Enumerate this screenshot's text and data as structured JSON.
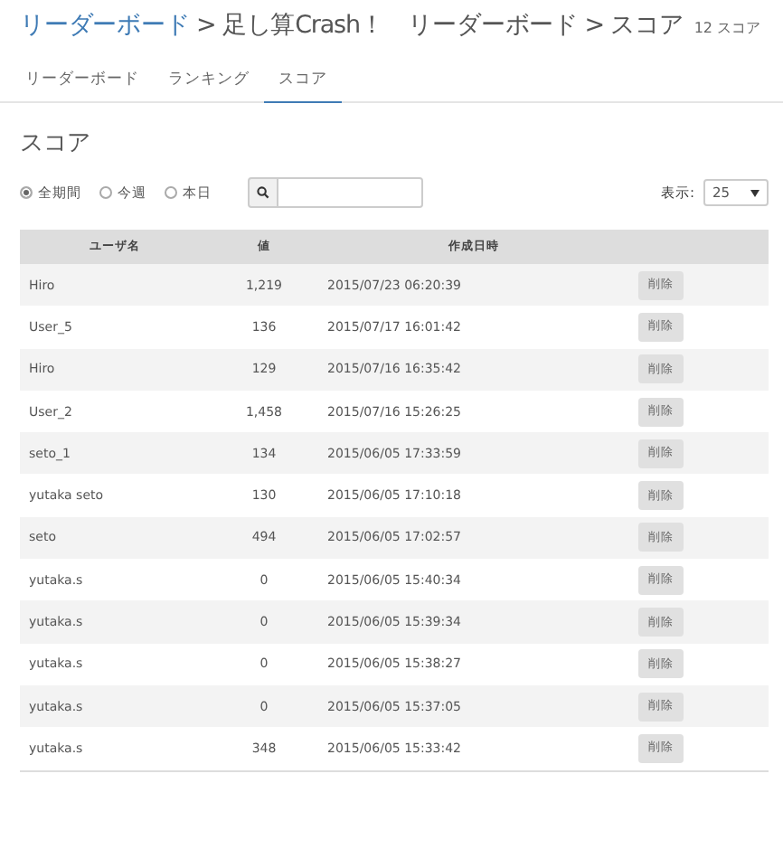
{
  "header": {
    "breadcrumb_link": "リーダーボード",
    "title_rest": " > 足し算Crash！　リーダーボード > スコア",
    "count": "12 スコア"
  },
  "tabs": [
    {
      "label": "リーダーボード",
      "selected": false
    },
    {
      "label": "ランキング",
      "selected": false
    },
    {
      "label": "スコア",
      "selected": true
    }
  ],
  "section_title": "スコア",
  "filters": [
    {
      "label": "全期間",
      "selected": true
    },
    {
      "label": "今週",
      "selected": false
    },
    {
      "label": "本日",
      "selected": false
    }
  ],
  "page_size": {
    "label": "表示:",
    "value": "25"
  },
  "table": {
    "columns": [
      "ユーザ名",
      "値",
      "作成日時"
    ],
    "rows": [
      {
        "name": "Hiro",
        "value": "1,219",
        "date": "2015/07/23 06:20:39",
        "action": "削除"
      },
      {
        "name": "User_5",
        "value": "136",
        "date": "2015/07/17 16:01:42",
        "action": "削除"
      },
      {
        "name": "Hiro",
        "value": "129",
        "date": "2015/07/16 16:35:42",
        "action": "削除"
      },
      {
        "name": "User_2",
        "value": "1,458",
        "date": "2015/07/16 15:26:25",
        "action": "削除"
      },
      {
        "name": "seto_1",
        "value": "134",
        "date": "2015/06/05 17:33:59",
        "action": "削除"
      },
      {
        "name": "yutaka seto",
        "value": "130",
        "date": "2015/06/05 17:10:18",
        "action": "削除"
      },
      {
        "name": "seto",
        "value": "494",
        "date": "2015/06/05 17:02:57",
        "action": "削除"
      },
      {
        "name": "yutaka.s",
        "value": "0",
        "date": "2015/06/05 15:40:34",
        "action": "削除"
      },
      {
        "name": "yutaka.s",
        "value": "0",
        "date": "2015/06/05 15:39:34",
        "action": "削除"
      },
      {
        "name": "yutaka.s",
        "value": "0",
        "date": "2015/06/05 15:38:27",
        "action": "削除"
      },
      {
        "name": "yutaka.s",
        "value": "0",
        "date": "2015/06/05 15:37:05",
        "action": "削除"
      },
      {
        "name": "yutaka.s",
        "value": "348",
        "date": "2015/06/05 15:33:42",
        "action": "削除"
      }
    ]
  }
}
